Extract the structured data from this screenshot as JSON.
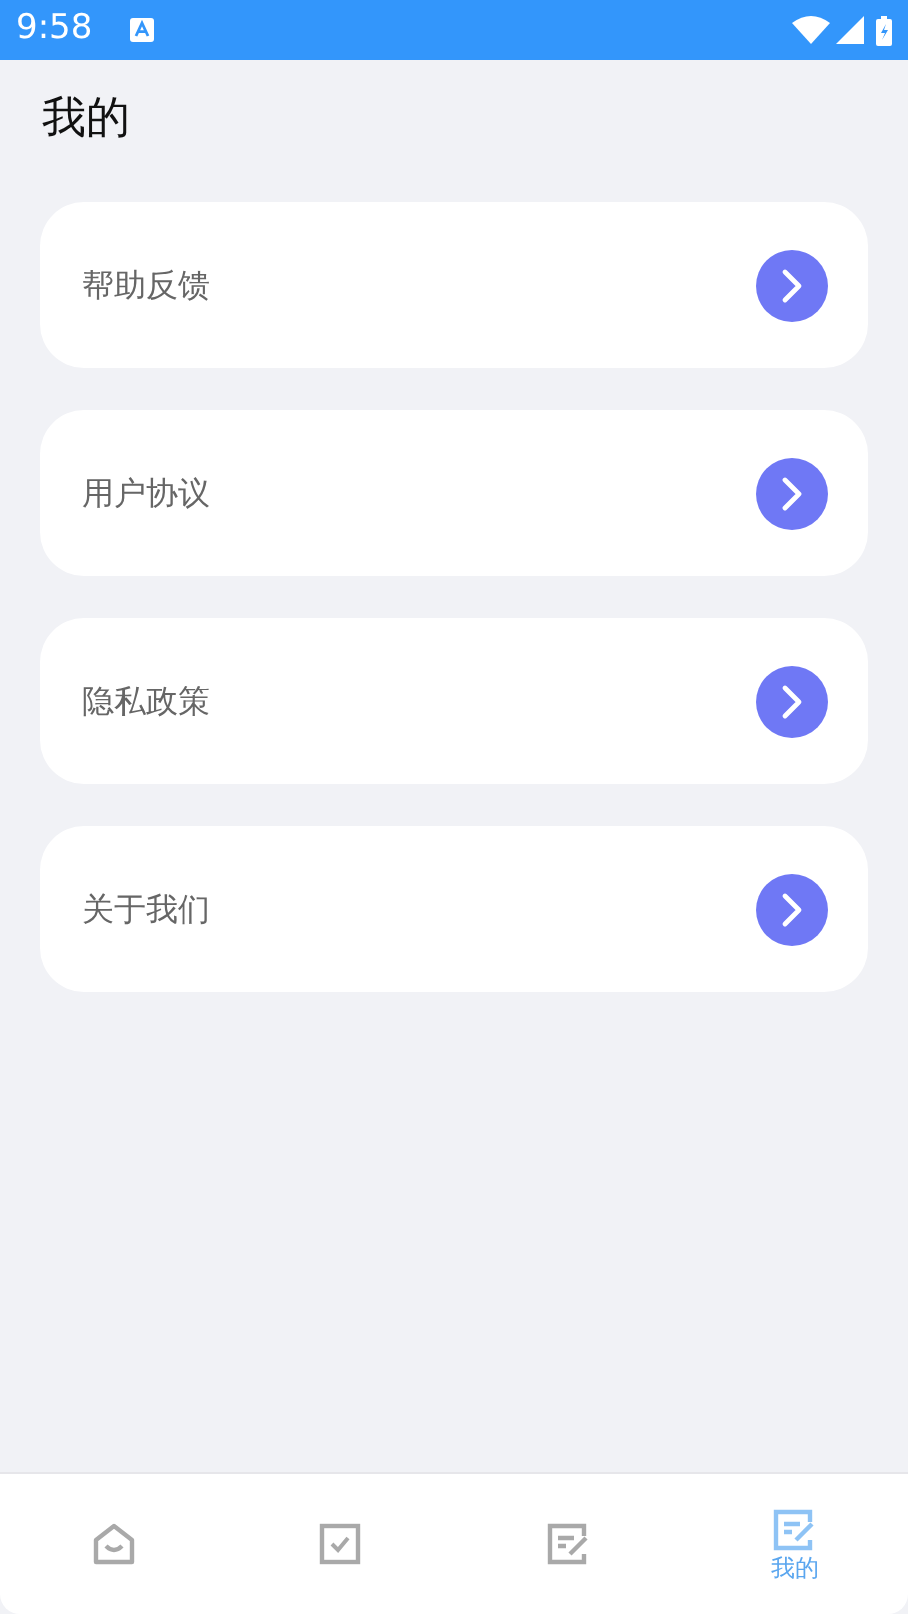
{
  "status_bar": {
    "time": "9:58"
  },
  "title": "我的",
  "menu_items": [
    {
      "label": "帮助反馈"
    },
    {
      "label": "用户协议"
    },
    {
      "label": "隐私政策"
    },
    {
      "label": "关于我们"
    }
  ],
  "tab_bar": [
    {
      "kind": "home",
      "selected": false
    },
    {
      "kind": "check",
      "selected": false
    },
    {
      "kind": "edit",
      "selected": false
    },
    {
      "kind": "edit",
      "selected": true,
      "label": "我的"
    }
  ]
}
